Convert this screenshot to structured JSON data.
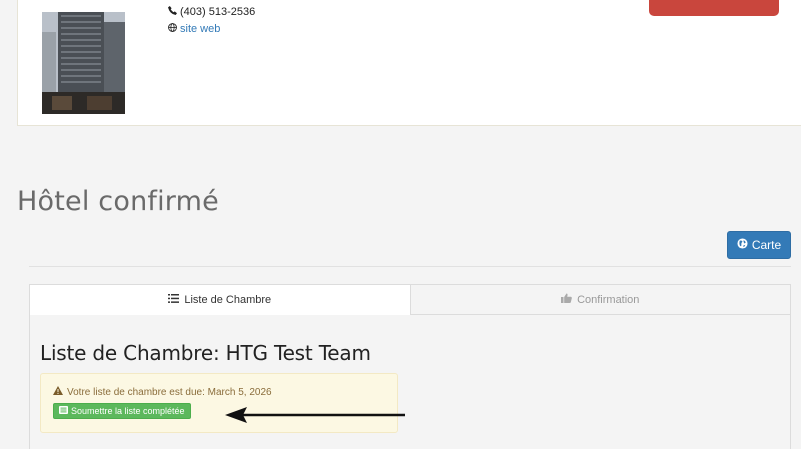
{
  "hotel": {
    "phone": "(403) 513-2536",
    "website_label": "site web"
  },
  "section_title": "Hôtel confirmé",
  "map_button_label": "Carte",
  "tabs": [
    {
      "label": "Liste de Chambre",
      "active": true,
      "icon": "list-icon"
    },
    {
      "label": "Confirmation",
      "active": false,
      "icon": "thumbs-up-icon"
    }
  ],
  "rooming": {
    "heading": "Liste de Chambre: HTG Test Team",
    "due_notice": "Votre liste de chambre est due: March 5, 2026",
    "submit_label": "Soumettre la liste complétée"
  },
  "colors": {
    "primary": "#337ab7",
    "success": "#5cb85c",
    "warning_bg": "#fcf8e3",
    "warning_text": "#8a6d3b",
    "danger": "#c9463d"
  }
}
